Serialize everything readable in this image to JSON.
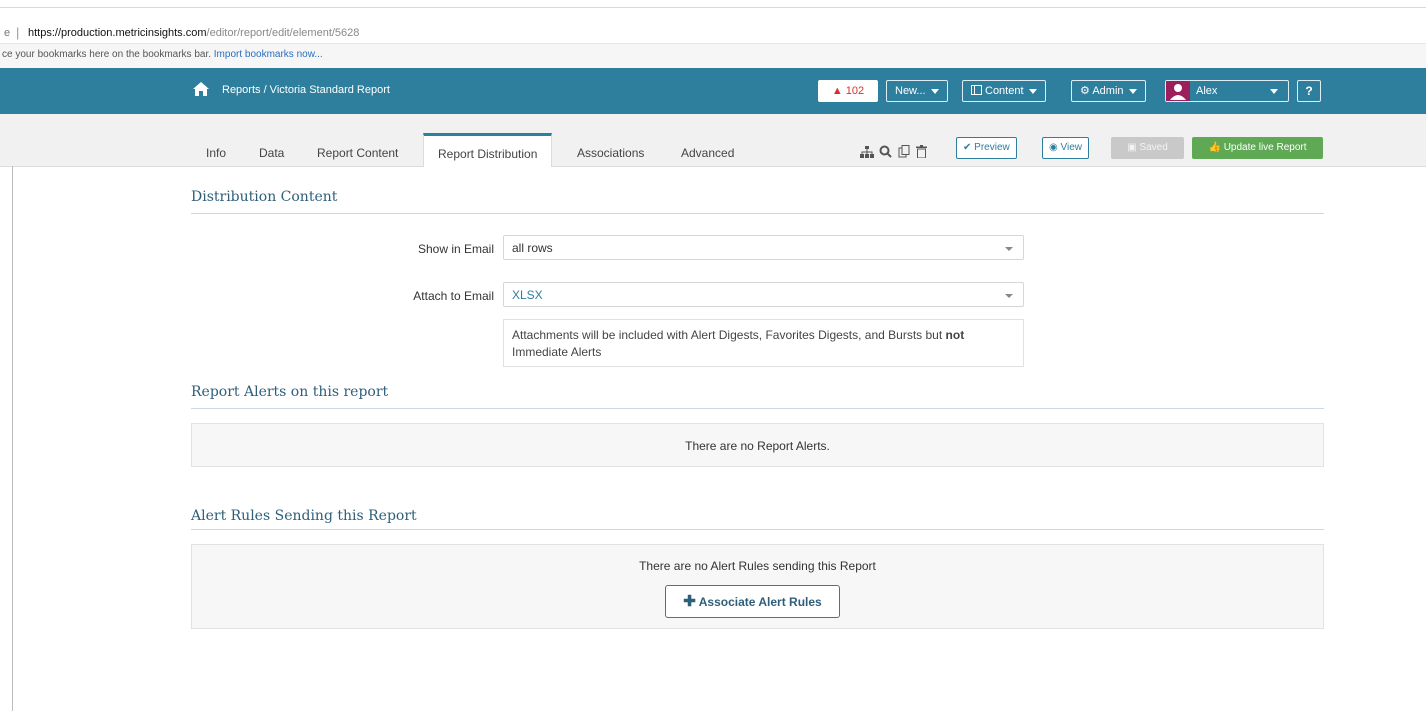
{
  "browser": {
    "address_lead": "e",
    "address_sep": "|",
    "url_host": "https://production.metricinsights.com",
    "url_path": "/editor/report/edit/element/5628",
    "bookmarks_text": "ce your bookmarks here on the bookmarks bar.",
    "bookmarks_link": "Import bookmarks now..."
  },
  "header": {
    "breadcrumb": "Reports / Victoria Standard Report",
    "alert_count": "102",
    "new_label": "New...",
    "content_label": "Content",
    "admin_label": "Admin",
    "user_name": "Alex",
    "help_label": "?",
    "bg_color": "#2e7f9e"
  },
  "tabs": [
    {
      "label": "Info"
    },
    {
      "label": "Data"
    },
    {
      "label": "Report Content"
    },
    {
      "label": "Report Distribution",
      "active": true
    },
    {
      "label": "Associations"
    },
    {
      "label": "Advanced"
    }
  ],
  "toolbar": {
    "preview_label": "Preview",
    "view_label": "View",
    "saved_label": "Saved",
    "update_label": "Update live Report"
  },
  "distribution": {
    "title": "Distribution Content",
    "show_label": "Show in Email",
    "show_value": "all rows",
    "attach_label": "Attach to Email",
    "attach_value": "XLSX",
    "hint_text": "Attachments will be included with Alert Digests, Favorites Digests, and Bursts but ",
    "hint_bold": "not",
    "hint_tail": " Immediate Alerts"
  },
  "report_alerts": {
    "title": "Report Alerts on this report",
    "empty_msg": "There are no Report Alerts."
  },
  "alert_rules": {
    "title": "Alert Rules Sending this Report",
    "empty_msg": "There are no Alert Rules sending this Report",
    "associate_label": "Associate Alert Rules"
  }
}
